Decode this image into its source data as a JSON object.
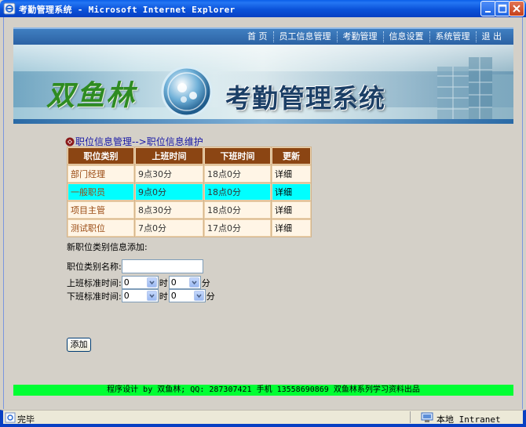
{
  "window": {
    "title": "考勤管理系统 - Microsoft Internet Explorer"
  },
  "nav": {
    "items": [
      "首 页",
      "员工信息管理",
      "考勤管理",
      "信息设置",
      "系统管理",
      "退 出"
    ]
  },
  "banner": {
    "brand": "双鱼林",
    "system_title": "考勤管理系统"
  },
  "breadcrumb": "职位信息管理-->职位信息维护",
  "table": {
    "headers": [
      "职位类别",
      "上班时间",
      "下班时间",
      "更新"
    ],
    "rows": [
      {
        "name": "部门经理",
        "start": "9点30分",
        "end": "18点0分",
        "action": "详细"
      },
      {
        "name": "一般职员",
        "start": "9点0分",
        "end": "18点0分",
        "action": "详细"
      },
      {
        "name": "项目主管",
        "start": "8点30分",
        "end": "18点0分",
        "action": "详细"
      },
      {
        "name": "测试职位",
        "start": "7点0分",
        "end": "17点0分",
        "action": "详细"
      }
    ]
  },
  "form": {
    "caption": "新职位类别信息添加:",
    "name_label": "职位类别名称:",
    "name_value": "",
    "start_label": "上班标准时间:",
    "end_label": "下班标准时间:",
    "hour_unit": "时",
    "minute_unit": "分",
    "start_hour": "0",
    "start_minute": "0",
    "end_hour": "0",
    "end_minute": "0",
    "submit_label": "添加"
  },
  "footer": "程序设计 by 双鱼林; QQ: 287307421 手机 13558690869 双鱼林系列学习资料出品",
  "status": {
    "text": "完毕",
    "zone": "本地 Intranet"
  }
}
